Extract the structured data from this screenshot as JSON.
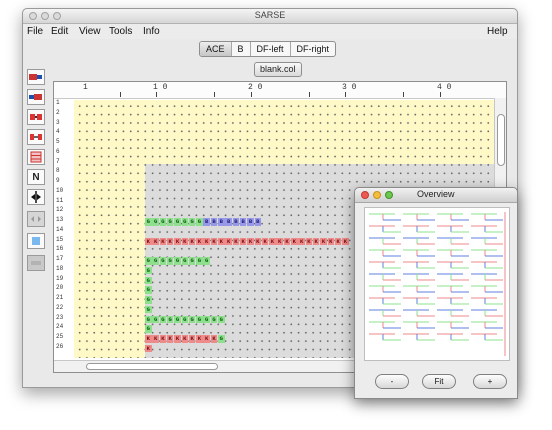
{
  "window": {
    "title": "SARSE"
  },
  "menu": {
    "file": "File",
    "edit": "Edit",
    "view": "View",
    "tools": "Tools",
    "info": "Info",
    "help": "Help"
  },
  "tabs": [
    "ACE",
    "B",
    "DF-left",
    "DF-right"
  ],
  "selected_tab": "ACE",
  "file_tab": "blank.col",
  "toolbar_buttons": [
    "insert-right-icon",
    "insert-left-icon",
    "block-a-icon",
    "block-b-icon",
    "grid-icon",
    "N",
    "split-icon",
    "arrows-icon",
    "square-icon",
    "dots-icon"
  ],
  "toolbar_N_label": "N",
  "ruler_labels": [
    "1",
    "1 0",
    "2 0",
    "3 0",
    "4 0"
  ],
  "row_labels": [
    "1",
    "2",
    "3",
    "4",
    "5",
    "6",
    "7",
    "8",
    "9",
    "10",
    "11",
    "12",
    "13",
    "14",
    "15",
    "16",
    "17",
    "18",
    "19",
    "20",
    "21",
    "22",
    "23",
    "24",
    "25",
    "26"
  ],
  "overview": {
    "title": "Overview",
    "buttons": {
      "minus": "-",
      "fit": "Fit",
      "plus": "+"
    }
  },
  "colors": {
    "G": "#8ee08e",
    "K": "#ee8a8a",
    "B": "#9898e8",
    "highlight": "#fff9c8",
    "gray_region": "#dcdcdc"
  },
  "sequence_rows": [
    {
      "row": 13,
      "text": "GGGGGGGGBBBBBBBB"
    },
    {
      "row": 15,
      "text": "KKKKKKKKKKKKKKKKKKKKKKKKKKKK"
    },
    {
      "row": 17,
      "text": "GGGGGGGGG"
    },
    {
      "row": 18,
      "text": "G"
    },
    {
      "row": 19,
      "text": "G"
    },
    {
      "row": 20,
      "text": "G"
    },
    {
      "row": 21,
      "text": "G"
    },
    {
      "row": 22,
      "text": "G"
    },
    {
      "row": 23,
      "text": "GGGGGGGGGGG"
    },
    {
      "row": 24,
      "text": "G"
    },
    {
      "row": 25,
      "text": "KKKKKKKKKKG"
    },
    {
      "row": 26,
      "text": "K"
    }
  ]
}
